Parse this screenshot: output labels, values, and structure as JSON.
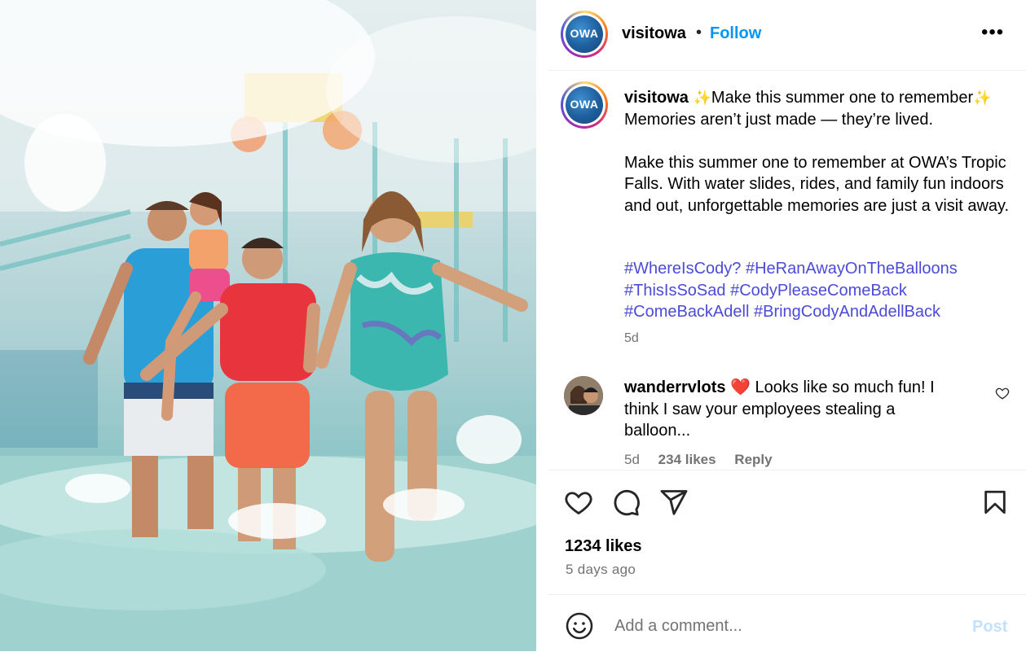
{
  "post": {
    "username": "visitowa",
    "follow_label": "Follow",
    "header_dot": "•",
    "more_label": "•••",
    "logo_text": "OWA",
    "photo_alt": "Family splashing in water park"
  },
  "caption": {
    "username": "visitowa",
    "spark": "✨",
    "line1": "Make this summer one to remember",
    "line2": "Memories aren’t just made — they’re lived.",
    "body": "Make this summer one to remember at OWA’s Tropic Falls. With water slides, rides, and family fun indoors and out, unforgettable memories are just a visit away.",
    "hashtags": [
      "#WhereIsCody?",
      "#HeRanAwayOnTheBalloons",
      "#ThisIsSoSad",
      "#CodyPleaseComeBack",
      "#ComeBackAdell",
      "#BringCodyAndAdellBack"
    ],
    "age": "5d"
  },
  "comment": {
    "username": "wanderrvlots",
    "heart": "❤️",
    "text": "Looks like so much fun! I think I saw your employees stealing a balloon...",
    "age": "5d",
    "likes": "234 likes",
    "reply": "Reply"
  },
  "stats": {
    "likes": "1234 likes",
    "time": "5 days ago"
  },
  "composer": {
    "placeholder": "Add a comment...",
    "post_label": "Post"
  },
  "colors": {
    "link_blue": "#0095f6",
    "hashtag": "#4b4bd8",
    "muted": "#737373",
    "post_disabled": "#c3e1fd"
  },
  "icons": {
    "like": "heart-icon",
    "comment": "comment-icon",
    "share": "send-icon",
    "save": "bookmark-icon",
    "emoji": "smiley-icon",
    "comment_like": "heart-icon"
  }
}
